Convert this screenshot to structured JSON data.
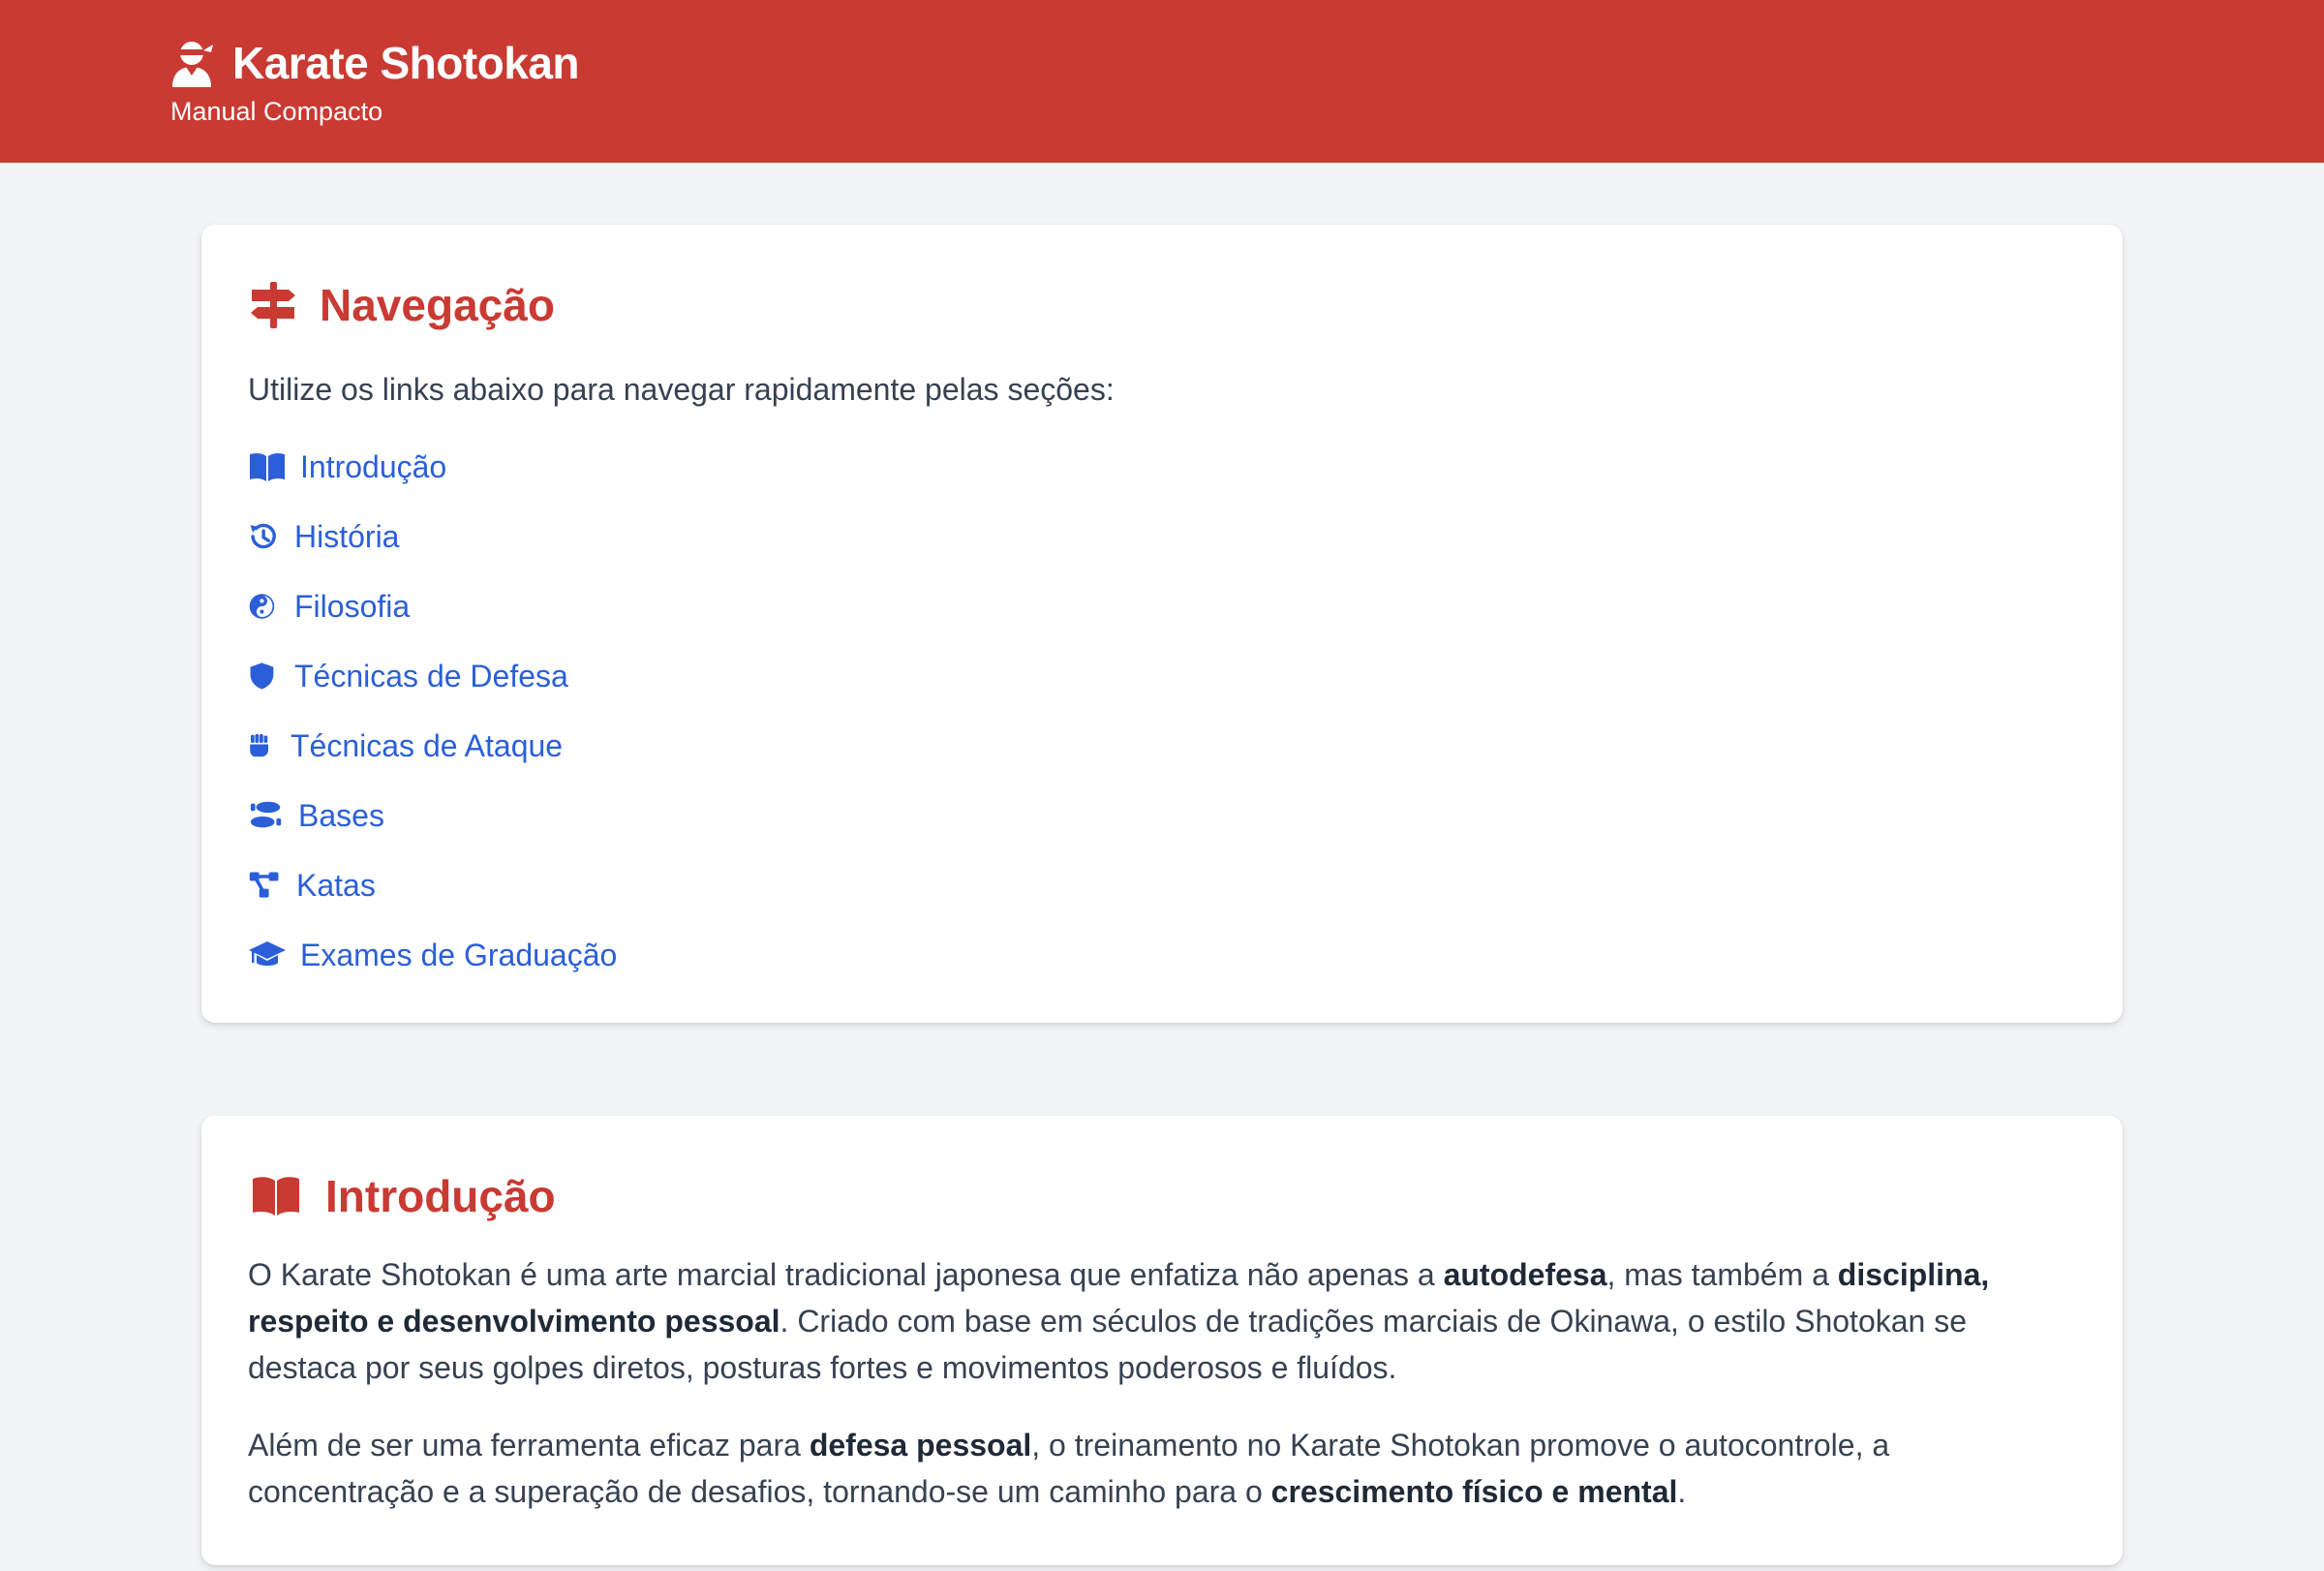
{
  "header": {
    "title": "Karate Shotokan",
    "subtitle": "Manual Compacto",
    "icon": "karate-user-icon"
  },
  "colors": {
    "brand": "#c93a32",
    "link": "#2b5fd9",
    "page_background": "#f3f4f6",
    "card_background": "#ffffff",
    "text": "#374151"
  },
  "nav": {
    "title": "Navegação",
    "icon": "signpost-icon",
    "intro": "Utilize os links abaixo para navegar rapidamente pelas seções:",
    "links": [
      {
        "label": "Introdução",
        "icon": "book-open-icon"
      },
      {
        "label": "História",
        "icon": "history-icon"
      },
      {
        "label": "Filosofia",
        "icon": "yin-yang-icon"
      },
      {
        "label": "Técnicas de Defesa",
        "icon": "shield-icon"
      },
      {
        "label": "Técnicas de Ataque",
        "icon": "fist-icon"
      },
      {
        "label": "Bases",
        "icon": "shoe-prints-icon"
      },
      {
        "label": "Katas",
        "icon": "diagram-icon"
      },
      {
        "label": "Exames de Graduação",
        "icon": "graduation-cap-icon"
      }
    ]
  },
  "intro": {
    "title": "Introdução",
    "icon": "book-open-icon",
    "p1": {
      "t1": "O Karate Shotokan é uma arte marcial tradicional japonesa que enfatiza não apenas a ",
      "b1": "autodefesa",
      "t2": ", mas também a ",
      "b2": "disciplina, respeito e desenvolvimento pessoal",
      "t3": ". Criado com base em séculos de tradições marciais de Okinawa, o estilo Shotokan se destaca por seus golpes diretos, posturas fortes e movimentos poderosos e fluídos."
    },
    "p2": {
      "t1": "Além de ser uma ferramenta eficaz para ",
      "b1": "defesa pessoal",
      "t2": ", o treinamento no Karate Shotokan promove o autocontrole, a concentração e a superação de desafios, tornando-se um caminho para o ",
      "b2": "crescimento físico e mental",
      "t3": "."
    }
  }
}
